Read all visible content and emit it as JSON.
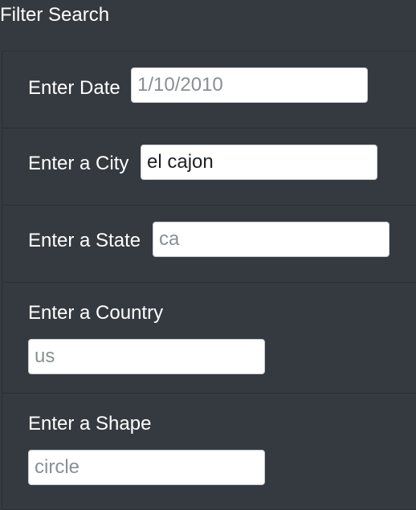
{
  "header": {
    "title": "Filter Search"
  },
  "filters": {
    "date": {
      "label": "Enter Date",
      "value": "",
      "placeholder": "1/10/2010"
    },
    "city": {
      "label": "Enter a City",
      "value": "el cajon",
      "placeholder": ""
    },
    "state": {
      "label": "Enter a State",
      "value": "",
      "placeholder": "ca"
    },
    "country": {
      "label": "Enter a Country",
      "value": "",
      "placeholder": "us"
    },
    "shape": {
      "label": "Enter a Shape",
      "value": "",
      "placeholder": "circle"
    }
  }
}
